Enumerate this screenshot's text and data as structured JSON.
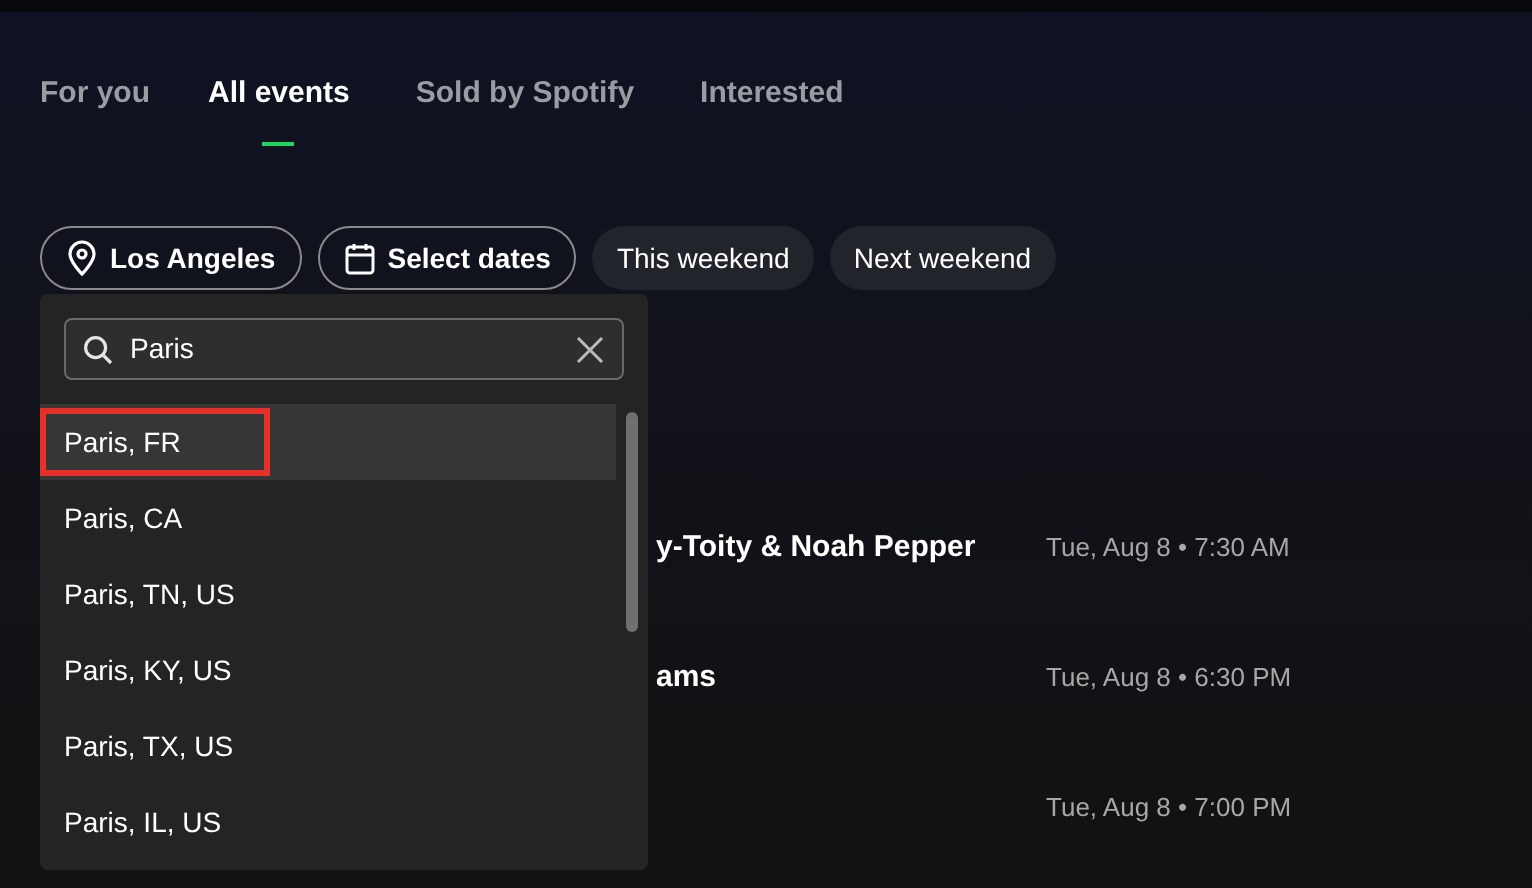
{
  "tabs": [
    {
      "label": "For you",
      "selected": false
    },
    {
      "label": "All events",
      "selected": true
    },
    {
      "label": "Sold by Spotify",
      "selected": false
    },
    {
      "label": "Interested",
      "selected": false
    }
  ],
  "filters": [
    {
      "kind": "location",
      "label": "Los Angeles"
    },
    {
      "kind": "dates",
      "label": "Select dates"
    },
    {
      "kind": "plain",
      "label": "This weekend"
    },
    {
      "kind": "plain",
      "label": "Next weekend"
    }
  ],
  "location_dropdown": {
    "search": {
      "value": "Paris"
    },
    "results": [
      {
        "label": "Paris, FR",
        "selected": true,
        "highlighted": true
      },
      {
        "label": "Paris, CA",
        "selected": false,
        "highlighted": false
      },
      {
        "label": "Paris, TN, US",
        "selected": false,
        "highlighted": false
      },
      {
        "label": "Paris, KY, US",
        "selected": false,
        "highlighted": false
      },
      {
        "label": "Paris, TX, US",
        "selected": false,
        "highlighted": false
      },
      {
        "label": "Paris, IL, US",
        "selected": false,
        "highlighted": false
      }
    ]
  },
  "events": [
    {
      "title": "y-Toity & Noah Pepper",
      "date": "Tue, Aug 8 • 7:30 AM"
    },
    {
      "title": "ams",
      "date": "Tue, Aug 8 • 6:30 PM"
    },
    {
      "date": "Tue, Aug 8 • 7:00 PM"
    }
  ]
}
